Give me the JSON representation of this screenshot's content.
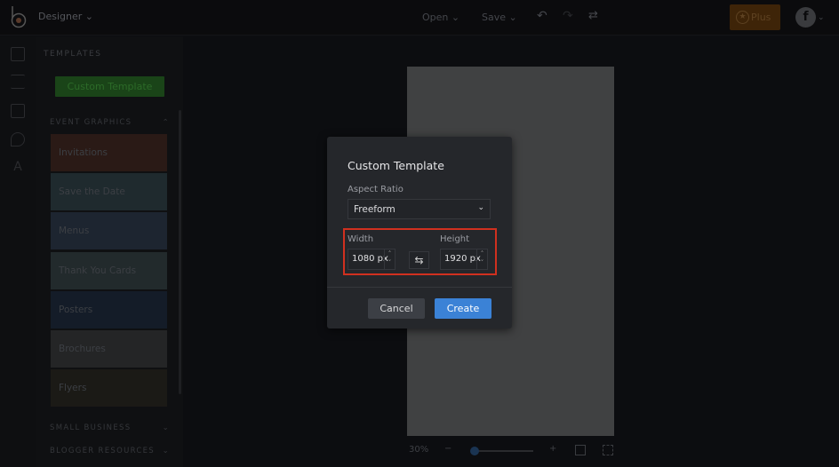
{
  "topbar": {
    "app_menu": "Designer ⌄",
    "open": "Open ⌄",
    "save": "Save ⌄",
    "plus": "Plus",
    "avatar_letter": "f"
  },
  "panel": {
    "title": "TEMPLATES",
    "custom_button": "Custom Template",
    "sections": [
      {
        "label": "EVENT GRAPHICS",
        "chevron": "⌃"
      },
      {
        "label": "SMALL BUSINESS",
        "chevron": "⌄"
      },
      {
        "label": "BLOGGER RESOURCES",
        "chevron": "⌄"
      }
    ],
    "items": [
      {
        "label": "Invitations",
        "color": "#2a1a16"
      },
      {
        "label": "Save the Date",
        "color": "#1f2a2e"
      },
      {
        "label": "Menus",
        "color": "#1d2530"
      },
      {
        "label": "Thank You Cards",
        "color": "#222a2c"
      },
      {
        "label": "Posters",
        "color": "#141c28"
      },
      {
        "label": "Brochures",
        "color": "#242526"
      },
      {
        "label": "Flyers",
        "color": "#1b1a16"
      }
    ]
  },
  "zoom": {
    "level": "30%",
    "minus": "−",
    "plus": "+",
    "slider_fraction": 0.05
  },
  "modal": {
    "title": "Custom Template",
    "aspect_label": "Aspect Ratio",
    "aspect_value": "Freeform",
    "width_label": "Width",
    "width_value": "1080 px",
    "height_label": "Height",
    "height_value": "1920 px",
    "cancel": "Cancel",
    "create": "Create"
  },
  "colors": {
    "accent": "#3b82d6",
    "highlight": "#d0301f"
  }
}
